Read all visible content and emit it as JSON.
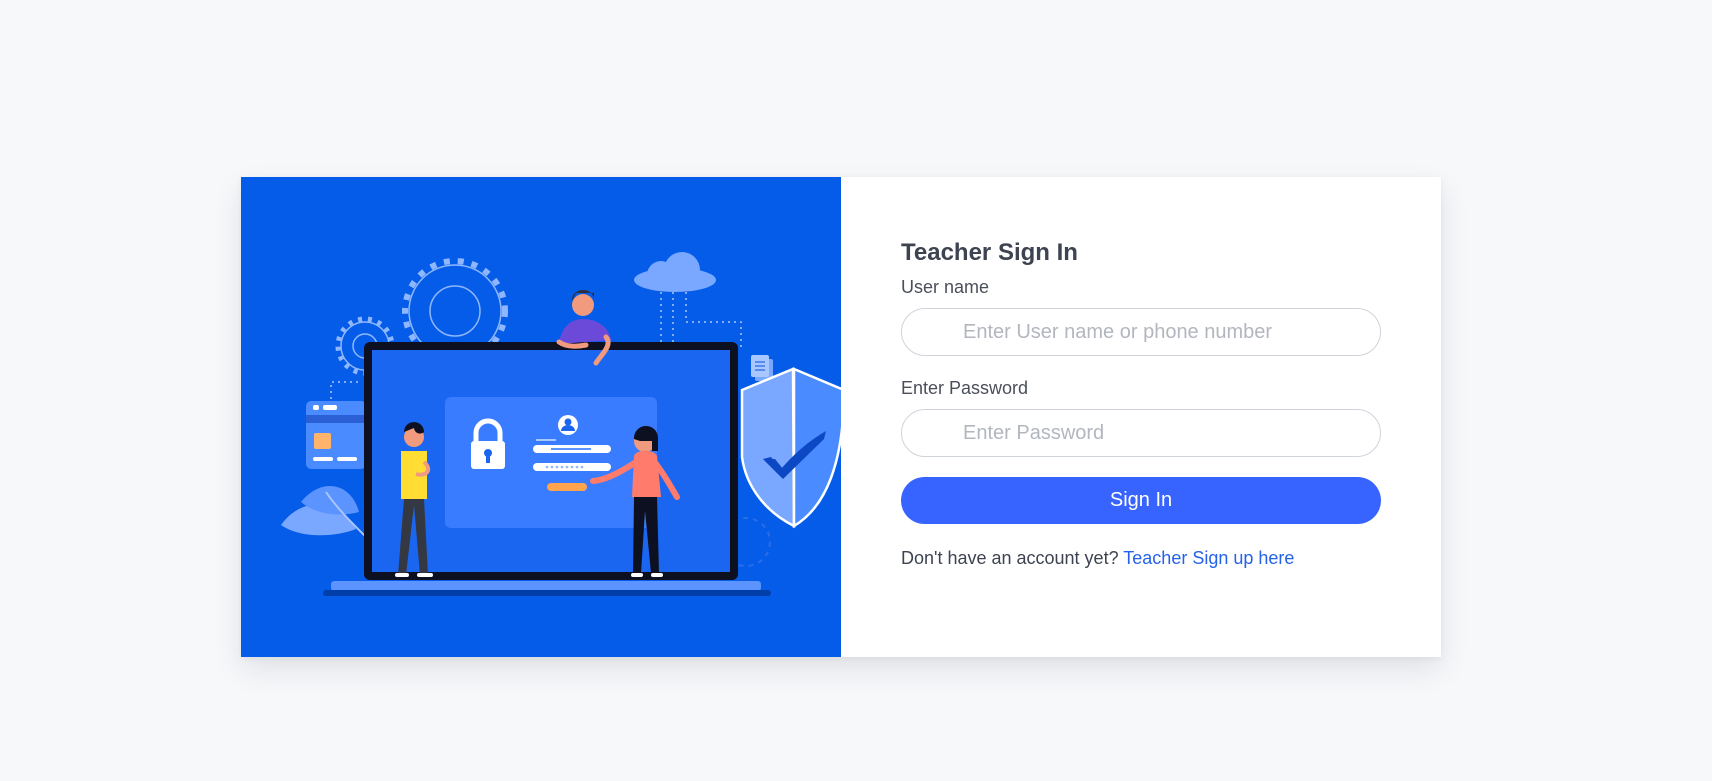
{
  "left_panel": {
    "illustration": "login-security-illustration",
    "background_color": "#045ce8"
  },
  "signin": {
    "title": "Teacher Sign In",
    "username_label": "User name",
    "username_placeholder": "Enter User name or phone number",
    "username_value": "",
    "password_label": "Enter Password",
    "password_placeholder": "Enter Password",
    "password_value": "",
    "button_label": "Sign In",
    "button_color": "#3763ff",
    "signup_prompt": "Don't have an account yet?",
    "signup_link": "Teacher Sign up here",
    "link_color": "#2462e8"
  }
}
